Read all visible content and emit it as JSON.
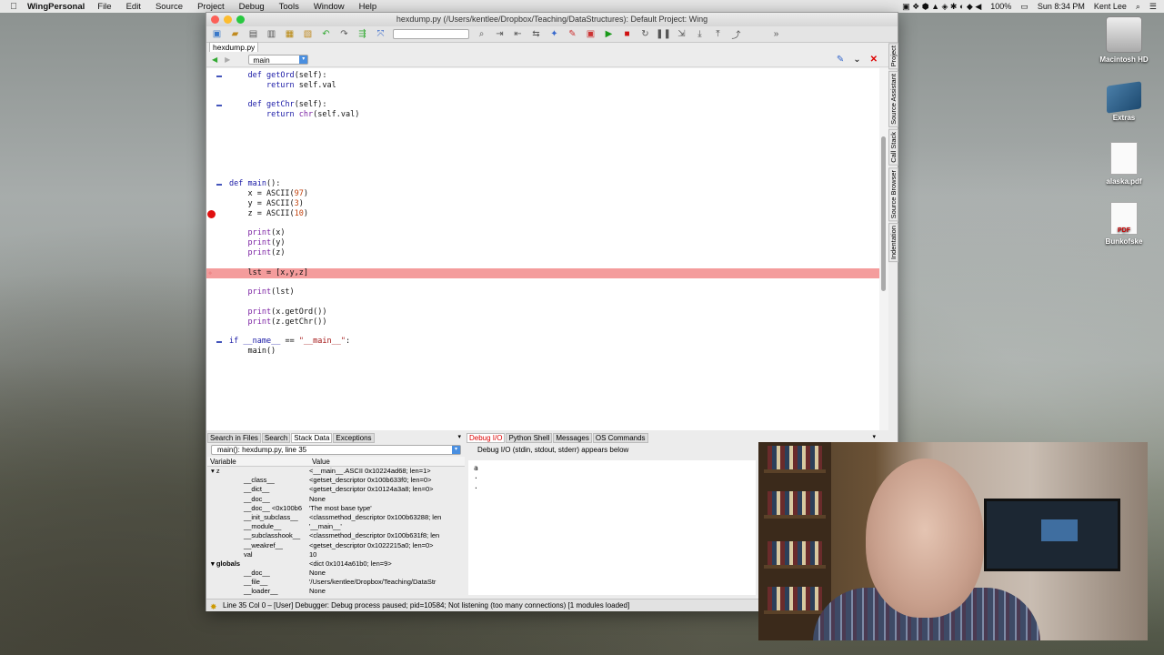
{
  "menubar": {
    "app_name": "WingPersonal",
    "items": [
      "File",
      "Edit",
      "Source",
      "Project",
      "Debug",
      "Tools",
      "Window",
      "Help"
    ],
    "battery": "100%",
    "clock": "Sun 8:34 PM",
    "user": "Kent Lee"
  },
  "desktop": {
    "icons": [
      "Macintosh HD",
      "Extras",
      "alaska.pdf",
      "Bunkofske"
    ],
    "pdf_badge": "PDF"
  },
  "window": {
    "title": "hexdump.py (/Users/kentlee/Dropbox/Teaching/DataStructures): Default Project: Wing",
    "file_tab": "hexdump.py",
    "scope_selector": "main",
    "side_tabs": [
      "Project",
      "Source Assistant",
      "Call Stack",
      "Source Browser",
      "Indentation"
    ]
  },
  "editor": {
    "current_line": 35
  },
  "stack_panel": {
    "tabs": [
      "Search in Files",
      "Search",
      "Stack Data",
      "Exceptions"
    ],
    "active_tab": "Stack Data",
    "frame": "main(): hexdump.py, line 35",
    "columns": [
      "Variable",
      "Value"
    ],
    "rows": [
      {
        "name": "▾ z",
        "value": "<__main__.ASCII 0x10224ad68; len=1>"
      },
      {
        "name": "__class__",
        "value": "<getset_descriptor 0x100b633f0; len=0>"
      },
      {
        "name": "__dict__",
        "value": "<getset_descriptor 0x10124a3a8; len=0>"
      },
      {
        "name": "__doc__",
        "value": "None"
      },
      {
        "name": "__doc__ <0x100b6",
        "value": "'The most base type'"
      },
      {
        "name": "__init_subclass__",
        "value": "<classmethod_descriptor 0x100b63288; len"
      },
      {
        "name": "__module__",
        "value": "'__main__'"
      },
      {
        "name": "__subclasshook__",
        "value": "<classmethod_descriptor 0x100b631f8; len"
      },
      {
        "name": "__weakref__",
        "value": "<getset_descriptor 0x1022215a0; len=0>"
      },
      {
        "name": "val",
        "value": "10"
      },
      {
        "name": "▾ globals",
        "value": "<dict 0x1014a61b0; len=9>"
      },
      {
        "name": "__doc__",
        "value": "None"
      },
      {
        "name": "__file__",
        "value": "'/Users/kentlee/Dropbox/Teaching/DataStr"
      },
      {
        "name": "__loader__",
        "value": "None"
      }
    ]
  },
  "debug_panel": {
    "tabs": [
      "Debug I/O",
      "Python Shell",
      "Messages",
      "OS Commands"
    ],
    "active_tab": "Debug I/O",
    "header": "Debug I/O (stdin, stdout, stderr) appears below",
    "output_lines": [
      "a",
      "",
      ""
    ]
  },
  "statusbar": {
    "text": "Line 35 Col 0 – [User] Debugger: Debug process paused; pid=10584; Not listening (too many connections) [1 modules loaded]"
  }
}
